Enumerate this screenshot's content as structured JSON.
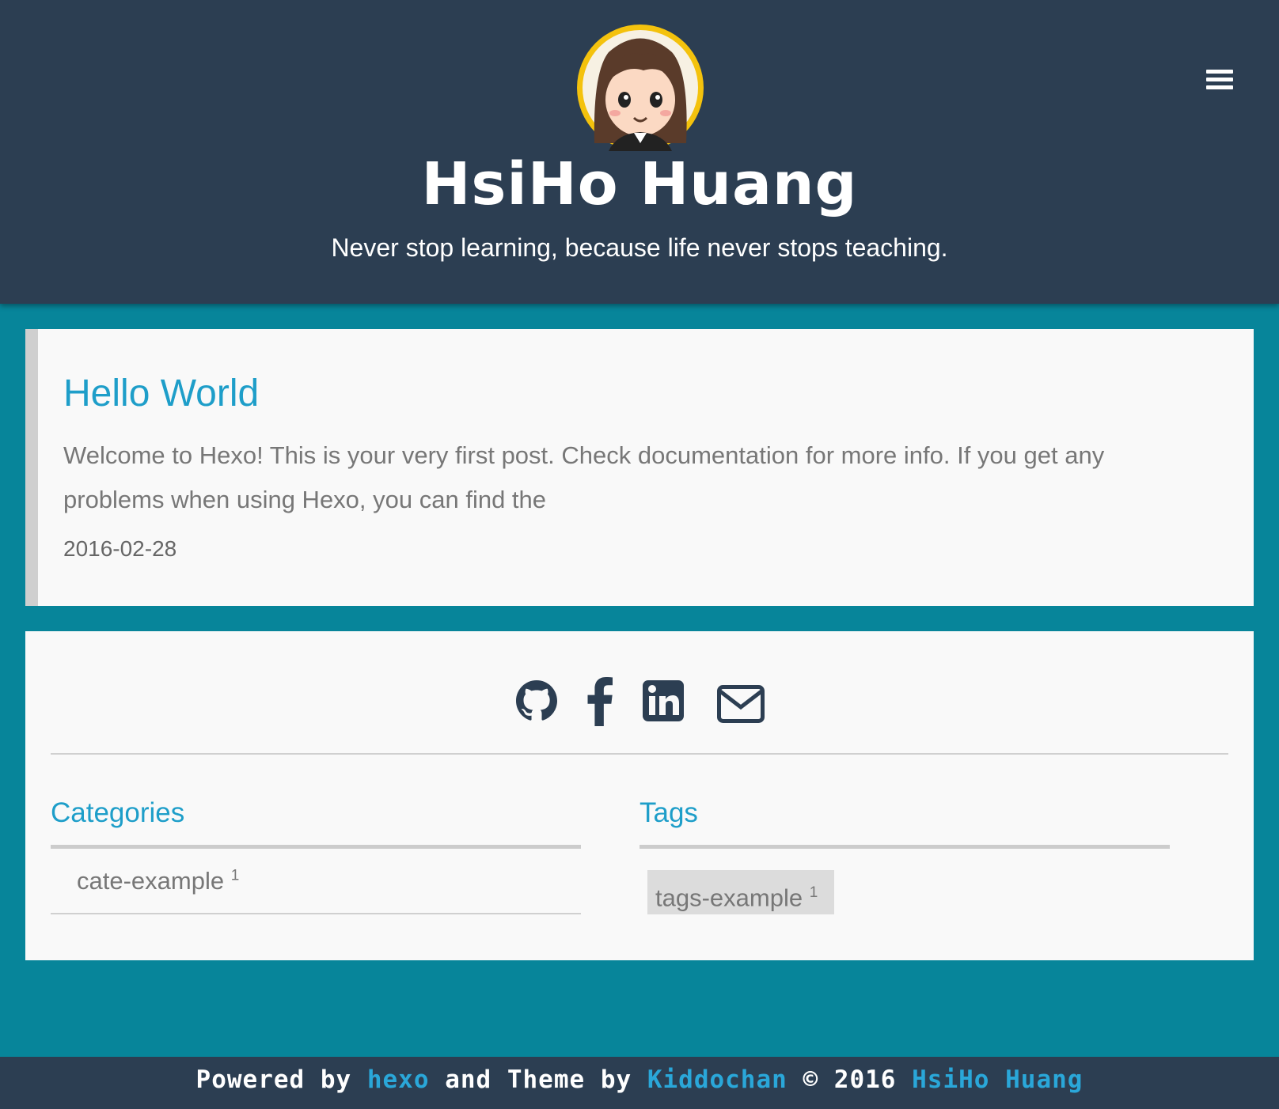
{
  "site": {
    "title": "HsiHo Huang",
    "subtitle": "Never stop learning, because life never stops teaching."
  },
  "header": {
    "menu_icon": "hamburger-menu-icon"
  },
  "post": {
    "title": "Hello World",
    "excerpt": "Welcome to Hexo! This is your very first post. Check documentation for more info. If you get any problems when using Hexo, you can find the",
    "date": "2016-02-28"
  },
  "social": {
    "icons": [
      "github-icon",
      "facebook-icon",
      "linkedin-icon",
      "email-icon"
    ],
    "color": "#2c3e52"
  },
  "categories": {
    "heading": "Categories",
    "items": [
      {
        "name": "cate-example",
        "count": "1"
      }
    ]
  },
  "tags": {
    "heading": "Tags",
    "items": [
      {
        "name": "tags-example",
        "count": "1"
      }
    ]
  },
  "footer": {
    "powered_by": "Powered by",
    "hexo": "hexo",
    "and_theme_by": "and Theme by",
    "theme_author": "Kiddochan",
    "copyright": "© 2016",
    "owner": "HsiHo Huang"
  },
  "colors": {
    "header_bg": "#2c3e52",
    "page_bg": "#07859a",
    "accent": "#1e9ec9",
    "card_bg": "#f9f9f9"
  }
}
